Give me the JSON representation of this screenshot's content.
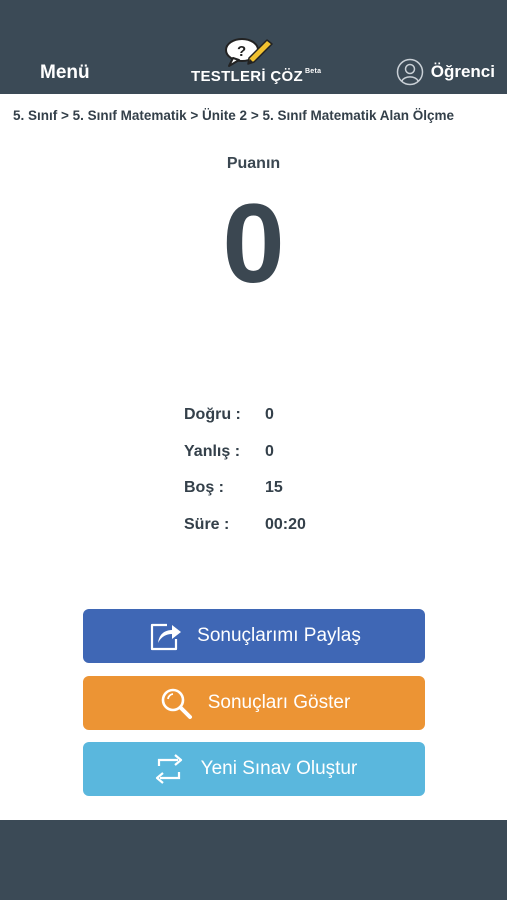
{
  "header": {
    "menu_label": "Menü",
    "logo_text": "TESTLERİ ÇÖZ",
    "logo_badge": "Beta",
    "user_label": "Öğrenci"
  },
  "breadcrumb": "5. Sınıf > 5. Sınıf Matematik > Ünite 2 > 5. Sınıf Matematik Alan Ölçme",
  "score": {
    "label": "Puanın",
    "value": "0"
  },
  "stats": [
    {
      "label": "Doğru :",
      "value": "0"
    },
    {
      "label": "Yanlış :",
      "value": "0"
    },
    {
      "label": "Boş :",
      "value": "15"
    },
    {
      "label": "Süre :",
      "value": "00:20"
    }
  ],
  "buttons": {
    "share": "Sonuçlarımı Paylaş",
    "show": "Sonuçları Göster",
    "new": "Yeni Sınav Oluştur"
  },
  "colors": {
    "header_bg": "#3b4a56",
    "share_bg": "#3f67b5",
    "show_bg": "#ec9434",
    "new_bg": "#5ab7dd",
    "logo_pencil": "#f2c230"
  }
}
